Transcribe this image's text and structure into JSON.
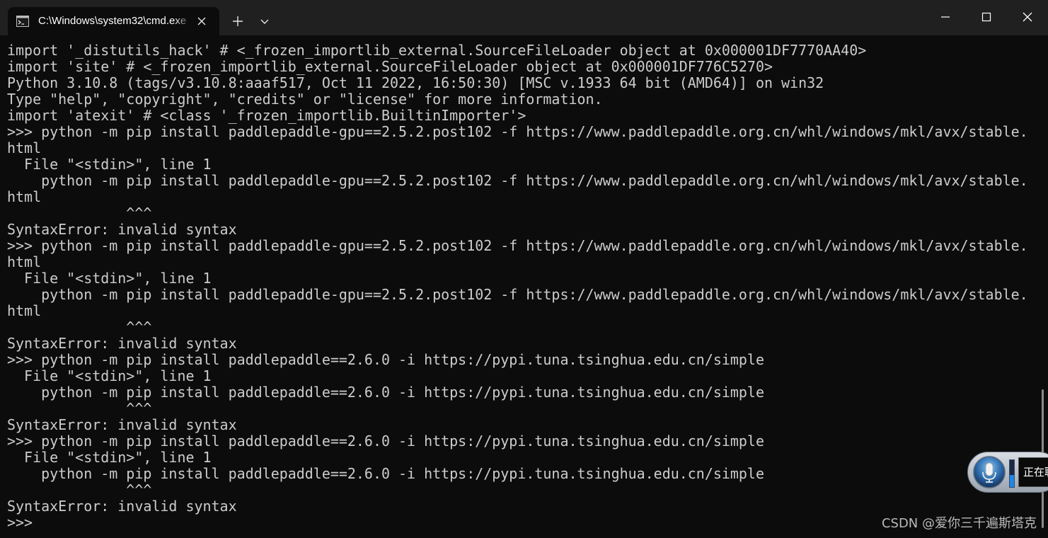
{
  "window": {
    "tab_title": "C:\\Windows\\system32\\cmd.exe",
    "colors": {
      "titlebar": "#202020",
      "terminal_bg": "#0c0c0c",
      "terminal_fg": "#cccccc"
    }
  },
  "terminal": {
    "lines": [
      "import '_distutils_hack' # <_frozen_importlib_external.SourceFileLoader object at 0x000001DF7770AA40>",
      "import 'site' # <_frozen_importlib_external.SourceFileLoader object at 0x000001DF776C5270>",
      "Python 3.10.8 (tags/v3.10.8:aaaf517, Oct 11 2022, 16:50:30) [MSC v.1933 64 bit (AMD64)] on win32",
      "Type \"help\", \"copyright\", \"credits\" or \"license\" for more information.",
      "import 'atexit' # <class '_frozen_importlib.BuiltinImporter'>",
      ">>> python -m pip install paddlepaddle-gpu==2.5.2.post102 -f https://www.paddlepaddle.org.cn/whl/windows/mkl/avx/stable.",
      "html",
      "  File \"<stdin>\", line 1",
      "    python -m pip install paddlepaddle-gpu==2.5.2.post102 -f https://www.paddlepaddle.org.cn/whl/windows/mkl/avx/stable.",
      "html",
      "              ^^^",
      "SyntaxError: invalid syntax",
      ">>> python -m pip install paddlepaddle-gpu==2.5.2.post102 -f https://www.paddlepaddle.org.cn/whl/windows/mkl/avx/stable.",
      "html",
      "  File \"<stdin>\", line 1",
      "    python -m pip install paddlepaddle-gpu==2.5.2.post102 -f https://www.paddlepaddle.org.cn/whl/windows/mkl/avx/stable.",
      "html",
      "              ^^^",
      "SyntaxError: invalid syntax",
      ">>> python -m pip install paddlepaddle==2.6.0 -i https://pypi.tuna.tsinghua.edu.cn/simple",
      "  File \"<stdin>\", line 1",
      "    python -m pip install paddlepaddle==2.6.0 -i https://pypi.tuna.tsinghua.edu.cn/simple",
      "              ^^^",
      "SyntaxError: invalid syntax",
      ">>> python -m pip install paddlepaddle==2.6.0 -i https://pypi.tuna.tsinghua.edu.cn/simple",
      "  File \"<stdin>\", line 1",
      "    python -m pip install paddlepaddle==2.6.0 -i https://pypi.tuna.tsinghua.edu.cn/simple",
      "              ^^^",
      "SyntaxError: invalid syntax",
      ">>>"
    ]
  },
  "speech_widget": {
    "status_text": "正在聆听",
    "level": 0.45
  },
  "watermark": {
    "text": "CSDN @爱你三千遍斯塔克"
  },
  "icons": {
    "tab": "terminal-icon",
    "tab_close": "close-icon",
    "new_tab": "plus-icon",
    "dropdown": "chevron-down-icon",
    "minimize": "minimize-icon",
    "maximize": "maximize-icon",
    "close": "close-icon",
    "mic": "microphone-icon"
  }
}
